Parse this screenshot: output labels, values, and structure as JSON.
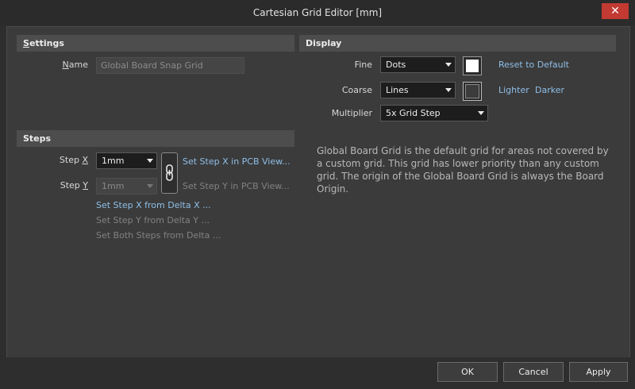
{
  "window": {
    "title": "Cartesian Grid Editor [mm]",
    "close_symbol": "✕"
  },
  "settings": {
    "header_prefix": "S",
    "header_rest": "ettings",
    "name_label_prefix": "N",
    "name_label_rest": "ame",
    "name_value": "Global Board Snap Grid"
  },
  "steps": {
    "header": "Steps",
    "step_x_label": "Step ",
    "step_x_hotkey": "X",
    "step_x_value": "1mm",
    "step_y_label": "Step ",
    "step_y_hotkey": "Y",
    "step_y_value": "1mm",
    "set_x_in_view": "Set Step X in PCB View...",
    "set_y_in_view": "Set Step Y in PCB View...",
    "set_x_delta": "Set Step X from Delta X ...",
    "set_y_delta": "Set Step Y from Delta Y ...",
    "set_both_delta": "Set Both Steps from Delta ...",
    "link_icon": "chain-link-icon"
  },
  "display": {
    "header": "Display",
    "fine_label": "Fine",
    "fine_value": "Dots",
    "fine_color": "#ffffff",
    "coarse_label": "Coarse",
    "coarse_value": "Lines",
    "coarse_color": "#3c3c3c",
    "multiplier_label": "Multiplier",
    "multiplier_value": "5x Grid Step",
    "reset_default": "Reset to Default",
    "lighter": "Lighter",
    "darker": "Darker",
    "description": "Global Board Grid is the default grid for areas not covered by a custom grid. This grid has lower priority than any custom grid. The origin of the Global Board Grid is always the Board Origin."
  },
  "buttons": {
    "ok": "OK",
    "cancel": "Cancel",
    "apply": "Apply"
  }
}
